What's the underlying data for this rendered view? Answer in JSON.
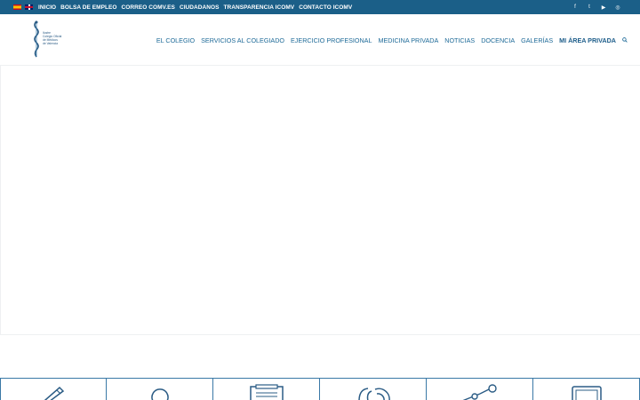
{
  "topbar": {
    "links": [
      "INICIO",
      "BOLSA DE EMPLEO",
      "CORREO COMV.ES",
      "CIUDADANOS",
      "TRANSPARENCIA ICOMV",
      "CONTACTO ICOMV"
    ],
    "languages": [
      "es",
      "en"
    ],
    "social": [
      {
        "icon": "facebook-icon",
        "glyph": "f"
      },
      {
        "icon": "twitter-icon",
        "glyph": "t"
      },
      {
        "icon": "youtube-icon",
        "glyph": "▶"
      },
      {
        "icon": "instagram-icon",
        "glyph": "◎"
      }
    ]
  },
  "logo": {
    "lines": [
      "Ilustre",
      "Colegio Oficial",
      "de Médicos",
      "de Valencia"
    ]
  },
  "nav": {
    "items": [
      "EL COLEGIO",
      "SERVICIOS AL COLEGIADO",
      "EJERCICIO PROFESIONAL",
      "MEDICINA PRIVADA",
      "NOTICIAS",
      "DOCENCIA",
      "GALERÍAS",
      "MI ÁREA PRIVADA"
    ],
    "active_index": 7
  },
  "boxes": [
    {
      "icon": "pencil-icon"
    },
    {
      "icon": "lightbulb-icon"
    },
    {
      "icon": "clipboard-icon"
    },
    {
      "icon": "contact-icon"
    },
    {
      "icon": "network-icon"
    },
    {
      "icon": "monitor-icon"
    }
  ],
  "colors": {
    "topbar": "#1b5f88",
    "nav_text": "#1e6a98",
    "box_border": "#3a78a6"
  }
}
